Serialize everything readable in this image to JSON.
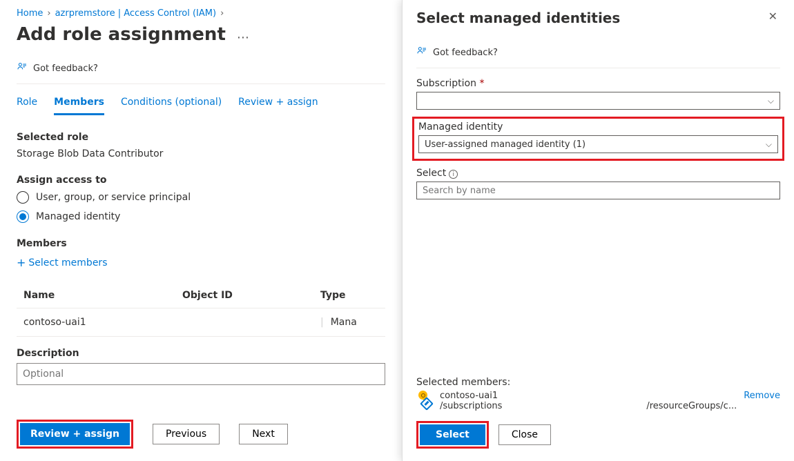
{
  "breadcrumb": {
    "home": "Home",
    "resource": "azrpremstore | Access Control (IAM)"
  },
  "page_title": "Add role assignment",
  "feedback": {
    "label": "Got feedback?"
  },
  "tabs": {
    "role": "Role",
    "members": "Members",
    "conditions": "Conditions (optional)",
    "review": "Review + assign"
  },
  "selected_role": {
    "label": "Selected role",
    "value": "Storage Blob Data Contributor"
  },
  "assign_access": {
    "label": "Assign access to",
    "option_user": "User, group, or service principal",
    "option_mi": "Managed identity"
  },
  "members": {
    "label": "Members",
    "select_link": "Select members",
    "table": {
      "col_name": "Name",
      "col_obj": "Object ID",
      "col_type": "Type",
      "rows": [
        {
          "name": "contoso-uai1",
          "object_id": "",
          "type": "Mana"
        }
      ]
    }
  },
  "description": {
    "label": "Description",
    "placeholder": "Optional"
  },
  "left_buttons": {
    "review_assign": "Review + assign",
    "previous": "Previous",
    "next": "Next"
  },
  "flyout": {
    "title": "Select managed identities",
    "subscription_label": "Subscription",
    "subscription_value": "",
    "mi_label": "Managed identity",
    "mi_value": "User-assigned managed identity (1)",
    "select_label": "Select",
    "search_placeholder": "Search by name",
    "selected_members_label": "Selected members:",
    "member": {
      "name": "contoso-uai1",
      "path1": "/subscriptions",
      "path2": "/resourceGroups/c..."
    },
    "remove": "Remove",
    "buttons": {
      "select": "Select",
      "close": "Close"
    }
  }
}
